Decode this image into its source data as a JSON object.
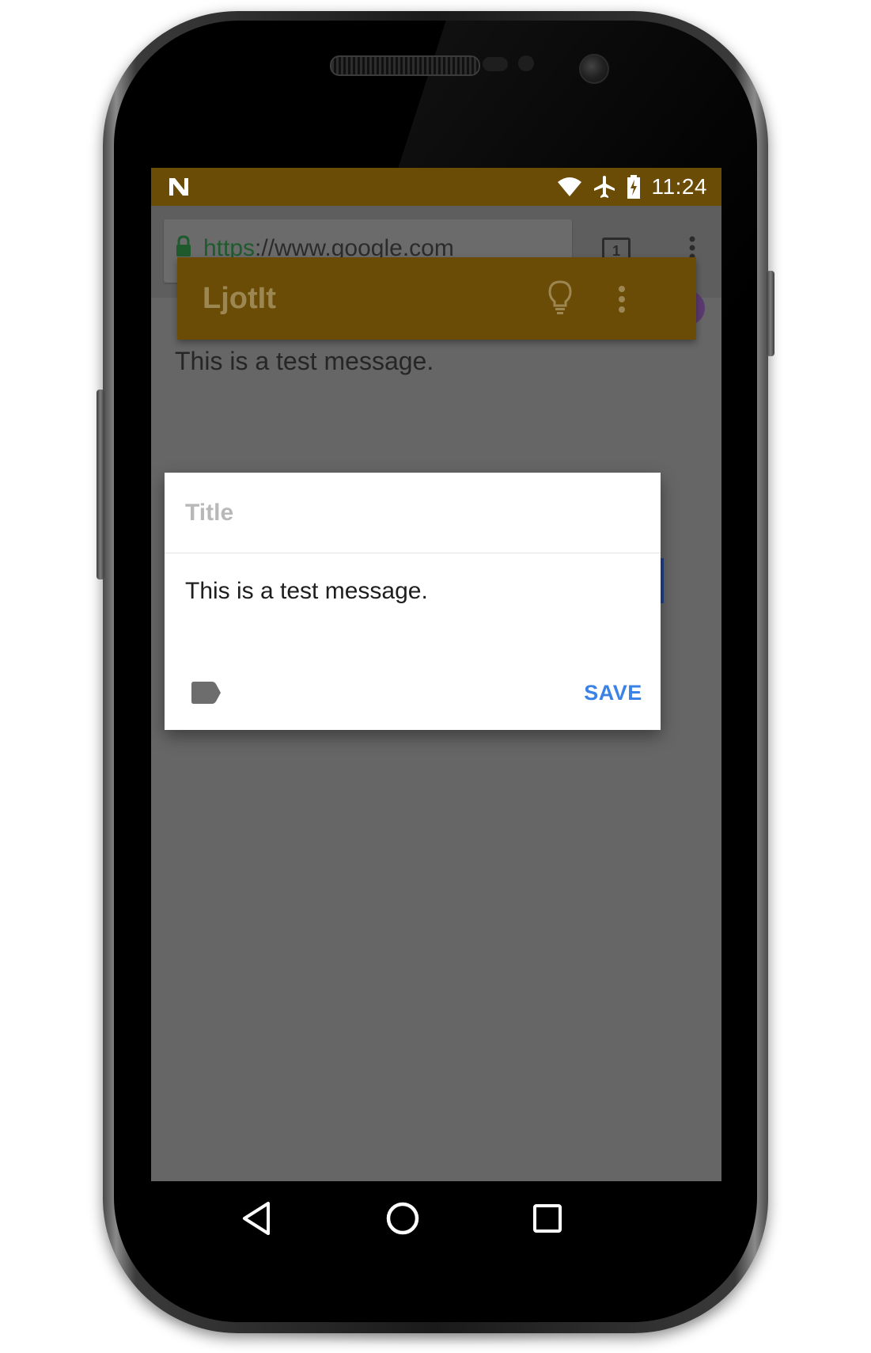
{
  "status_bar": {
    "time": "11:24",
    "icons": [
      "notification-n-icon",
      "wifi-icon",
      "airplane-icon",
      "battery-charging-icon"
    ],
    "color": "#6a4c06"
  },
  "browser": {
    "url_scheme": "https",
    "url_rest": "://www.google.com",
    "tab_count": "1",
    "icons": [
      "lock-icon",
      "tabs-icon",
      "more-vert-icon"
    ]
  },
  "app_bar": {
    "title": "LjotIt",
    "icons": [
      "lightbulb-icon",
      "more-vert-icon"
    ],
    "color": "#6a4c06"
  },
  "background_note": {
    "text": "This is a test message."
  },
  "dialog": {
    "title_placeholder": "Title",
    "title_value": "",
    "body_text": "This is a test message.",
    "label_icon": "label-tag-icon",
    "save_label": "SAVE",
    "save_color": "#3b82e6"
  },
  "nav_bar": {
    "icons": [
      "back-icon",
      "home-icon",
      "recents-icon"
    ]
  }
}
